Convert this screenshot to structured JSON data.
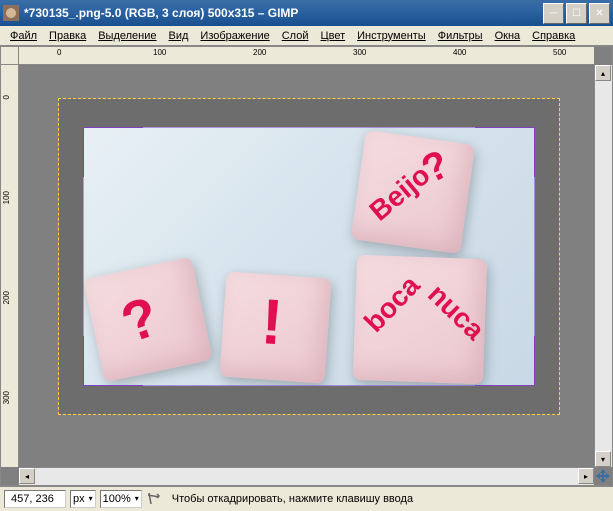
{
  "title": "*730135_.png-5.0 (RGB, 3 слоя) 500x315 – GIMP",
  "menu": {
    "file": "Файл",
    "edit": "Правка",
    "select": "Выделение",
    "view": "Вид",
    "image": "Изображение",
    "layer": "Слой",
    "color": "Цвет",
    "tools": "Инструменты",
    "filters": "Фильтры",
    "windows": "Окна",
    "help": "Справка"
  },
  "ruler_h": [
    "0",
    "100",
    "200",
    "300",
    "400",
    "500"
  ],
  "ruler_v": [
    "0",
    "100",
    "200",
    "300"
  ],
  "dice_text": {
    "d1": "?",
    "d2": "!",
    "d3a": "?",
    "d3b": "Beijo",
    "d4a": "boca",
    "d4b": "nuca"
  },
  "status": {
    "coords": "457, 236",
    "unit": "px",
    "zoom": "100%",
    "hint": "Чтобы откадрировать, нажмите клавишу ввода"
  }
}
